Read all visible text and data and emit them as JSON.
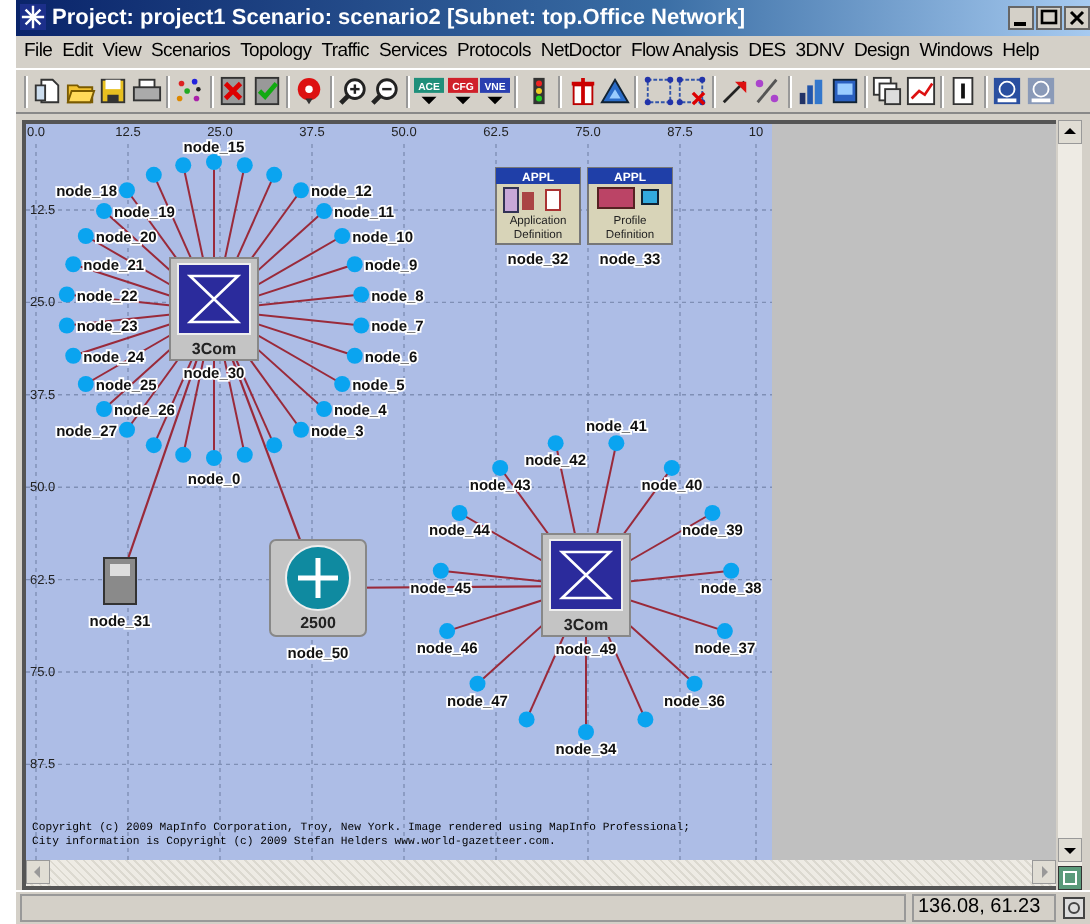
{
  "window": {
    "title": "Project: project1 Scenario: scenario2  [Subnet: top.Office Network]"
  },
  "menu": [
    "File",
    "Edit",
    "View",
    "Scenarios",
    "Topology",
    "Traffic",
    "Services",
    "Protocols",
    "NetDoctor",
    "Flow Analysis",
    "DES",
    "3DNV",
    "Design",
    "Windows",
    "Help"
  ],
  "toolbar": {
    "groups": [
      [
        {
          "kind": "doc"
        },
        {
          "kind": "folder"
        },
        {
          "kind": "disk"
        },
        {
          "kind": "printer"
        }
      ],
      [
        {
          "kind": "nodes"
        }
      ],
      [
        {
          "kind": "x"
        },
        {
          "kind": "check"
        }
      ],
      [
        {
          "kind": "pin"
        }
      ],
      [
        {
          "kind": "zoom-in"
        },
        {
          "kind": "zoom-out"
        }
      ],
      [
        {
          "kind": "badge",
          "text": "ACE",
          "color": "#1f8f7a"
        },
        {
          "kind": "badge",
          "text": "CFG",
          "color": "#d0202a"
        },
        {
          "kind": "badge",
          "text": "VNE",
          "color": "#2a3fb0"
        }
      ],
      [
        {
          "kind": "traffic-light"
        }
      ],
      [
        {
          "kind": "tower"
        },
        {
          "kind": "triangle"
        }
      ],
      [
        {
          "kind": "grid"
        },
        {
          "kind": "grid-x"
        }
      ],
      [
        {
          "kind": "arrow"
        },
        {
          "kind": "percent"
        }
      ],
      [
        {
          "kind": "chart"
        },
        {
          "kind": "monitor"
        }
      ],
      [
        {
          "kind": "windows"
        },
        {
          "kind": "graph"
        }
      ],
      [
        {
          "kind": "info"
        }
      ],
      [
        {
          "kind": "ipv6"
        },
        {
          "kind": "ipv6-grey"
        }
      ]
    ]
  },
  "map": {
    "x_ruler": [
      "0.0",
      "12.5",
      "25.0",
      "37.5",
      "50.0",
      "62.5",
      "75.0",
      "87.5",
      "10"
    ],
    "y_ruler": [
      "12.5",
      "25.0",
      "37.5",
      "50.0",
      "62.5",
      "75.0",
      "87.5"
    ],
    "hubs": [
      {
        "vendor": "3Com",
        "label": "node_30",
        "spokes": [
          {
            "kind": "node",
            "label": "node_15"
          },
          {
            "kind": "dot"
          },
          {
            "kind": "dot"
          },
          {
            "kind": "dot"
          },
          {
            "kind": "dot"
          },
          {
            "kind": "node",
            "label": "node_18"
          },
          {
            "kind": "node",
            "label": "node_12"
          },
          {
            "kind": "node",
            "label": "node_19"
          },
          {
            "kind": "node",
            "label": "node_11"
          },
          {
            "kind": "node",
            "label": "node_20"
          },
          {
            "kind": "node",
            "label": "node_10"
          },
          {
            "kind": "node",
            "label": "node_21"
          },
          {
            "kind": "node",
            "label": "node_9"
          },
          {
            "kind": "node",
            "label": "node_22"
          },
          {
            "kind": "node",
            "label": "node_8"
          },
          {
            "kind": "node",
            "label": "node_23"
          },
          {
            "kind": "node",
            "label": "node_7"
          },
          {
            "kind": "node",
            "label": "node_24"
          },
          {
            "kind": "node",
            "label": "node_6"
          },
          {
            "kind": "node",
            "label": "node_25"
          },
          {
            "kind": "node",
            "label": "node_5"
          },
          {
            "kind": "node",
            "label": "node_26"
          },
          {
            "kind": "node",
            "label": "node_4"
          },
          {
            "kind": "node",
            "label": "node_27"
          },
          {
            "kind": "node",
            "label": "node_3"
          },
          {
            "kind": "dot"
          },
          {
            "kind": "dot"
          },
          {
            "kind": "dot"
          },
          {
            "kind": "dot"
          },
          {
            "kind": "node",
            "label": "node_0"
          }
        ]
      },
      {
        "vendor": "3Com",
        "label": "node_49",
        "spokes": [
          {
            "kind": "node",
            "label": "node_42"
          },
          {
            "kind": "node",
            "label": "node_41"
          },
          {
            "kind": "node",
            "label": "node_43"
          },
          {
            "kind": "node",
            "label": "node_40"
          },
          {
            "kind": "node",
            "label": "node_44"
          },
          {
            "kind": "node",
            "label": "node_39"
          },
          {
            "kind": "node",
            "label": "node_45"
          },
          {
            "kind": "node",
            "label": "node_38"
          },
          {
            "kind": "node",
            "label": "node_46"
          },
          {
            "kind": "node",
            "label": "node_37"
          },
          {
            "kind": "node",
            "label": "node_47"
          },
          {
            "kind": "node",
            "label": "node_36"
          },
          {
            "kind": "dot"
          },
          {
            "kind": "dot"
          },
          {
            "kind": "node",
            "label": "node_34"
          }
        ]
      }
    ],
    "devices": [
      {
        "kind": "server",
        "label": "node_31"
      },
      {
        "kind": "router",
        "model": "2500",
        "label": "node_50"
      },
      {
        "kind": "application",
        "header": "APPL",
        "title_lines": [
          "Application",
          "Definition"
        ],
        "label": "node_32"
      },
      {
        "kind": "profile",
        "header": "APPL",
        "title_lines": [
          "Profile",
          "Definition"
        ],
        "label": "node_33"
      }
    ],
    "copyright": [
      "Copyright (c) 2009 MapInfo Corporation, Troy, New York. Image rendered using MapInfo Professional;",
      "City information is Copyright (c) 2009 Stefan Helders www.world-gazetteer.com."
    ]
  },
  "status_bar": {
    "coordinates": "136.08, 61.23"
  }
}
